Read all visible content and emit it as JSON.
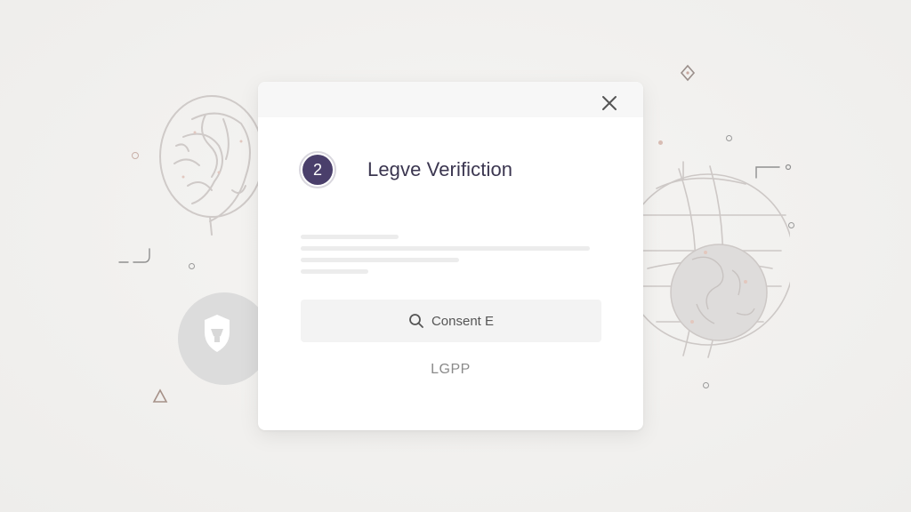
{
  "dialog": {
    "step_number": "2",
    "title": "Legve Verifiction",
    "consent_button_label": "Consent E",
    "footer_label": "LGPP"
  },
  "icons": {
    "close": "close-icon",
    "search": "search-icon",
    "shield": "shield-icon",
    "brain": "brain-illustration",
    "globe": "globe-illustration"
  },
  "colors": {
    "accent": "#4a3f6b",
    "title": "#3b3650",
    "background": "#f2f1ef"
  }
}
